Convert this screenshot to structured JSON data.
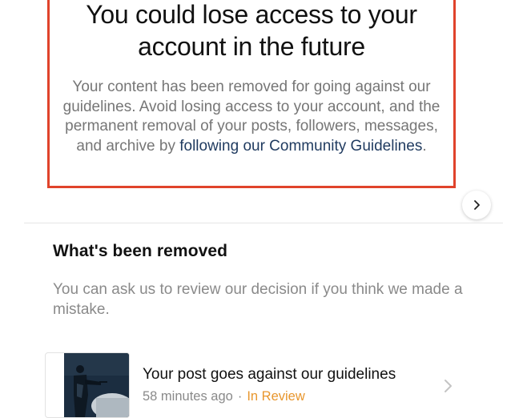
{
  "warning": {
    "title": "You could lose access to your account in the future",
    "body": "Your content has been removed for going against our guidelines. Avoid losing access to your account, and the permanent removal of your posts, followers, messages, and archive by ",
    "link_text": "following our Community Guidelines",
    "trailing": ".",
    "border_color": "#e0432b"
  },
  "carousel": {
    "next_icon": "chevron-right-icon"
  },
  "removed_section": {
    "title": "What's been removed",
    "description": "You can ask us to review our decision if you think we made a mistake."
  },
  "items": [
    {
      "title": "Your post goes against our guidelines",
      "time": "58 minutes ago",
      "separator": "·",
      "status": "In Review",
      "status_color": "#e8962d",
      "chevron_icon": "chevron-right-icon"
    }
  ]
}
